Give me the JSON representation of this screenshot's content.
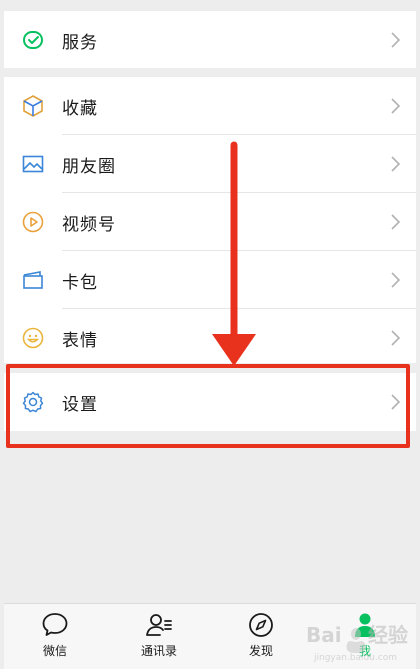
{
  "menu": {
    "services": {
      "label": "服务",
      "icon": "services-icon"
    },
    "items": [
      {
        "label": "收藏",
        "icon": "favorites-cube-icon"
      },
      {
        "label": "朋友圈",
        "icon": "moments-photo-icon"
      },
      {
        "label": "视频号",
        "icon": "channels-play-icon"
      },
      {
        "label": "卡包",
        "icon": "card-wallet-icon"
      },
      {
        "label": "表情",
        "icon": "sticker-smile-icon"
      }
    ],
    "settings": {
      "label": "设置",
      "icon": "settings-gear-icon"
    }
  },
  "tabbar": {
    "tabs": [
      {
        "label": "微信",
        "icon": "chat-bubble-icon",
        "active": false
      },
      {
        "label": "通讯录",
        "icon": "contacts-icon",
        "active": false
      },
      {
        "label": "发现",
        "icon": "compass-icon",
        "active": false
      },
      {
        "label": "我",
        "icon": "me-person-icon",
        "active": true
      }
    ]
  },
  "watermark": {
    "brand": "Bai",
    "brand2": "经验",
    "sub": "jingyan.baidu.com"
  },
  "colors": {
    "accent": "#07c160",
    "annotation": "#e8321e",
    "background": "#ededed"
  }
}
